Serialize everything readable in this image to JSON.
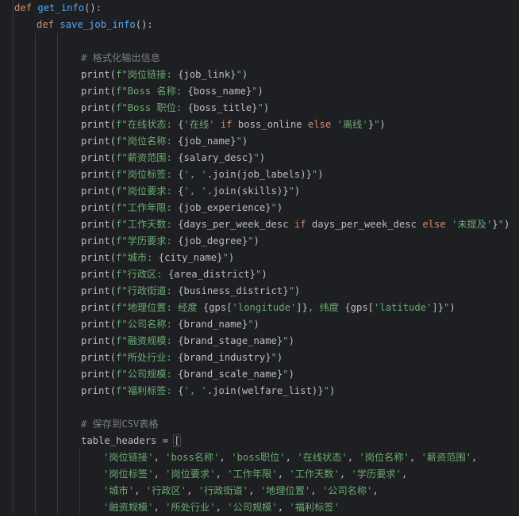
{
  "lines": [
    [
      [
        "kw",
        "def "
      ],
      [
        "fn",
        "get_info"
      ],
      [
        "plain",
        "():"
      ]
    ],
    [
      [
        "kw",
        "def "
      ],
      [
        "fn",
        "save_job_info"
      ],
      [
        "plain",
        "():"
      ]
    ],
    [],
    [
      [
        "cmt",
        "# 格式化输出信息"
      ]
    ],
    [
      [
        "plain",
        "print("
      ],
      [
        "str",
        "f\"岗位链接: "
      ],
      [
        "plain",
        "{job_link}"
      ],
      [
        "str",
        "\""
      ],
      [
        "plain",
        ")"
      ]
    ],
    [
      [
        "plain",
        "print("
      ],
      [
        "str",
        "f\"Boss 名称: "
      ],
      [
        "plain",
        "{boss_name}"
      ],
      [
        "str",
        "\""
      ],
      [
        "plain",
        ")"
      ]
    ],
    [
      [
        "plain",
        "print("
      ],
      [
        "str",
        "f\"Boss 职位: "
      ],
      [
        "plain",
        "{boss_title}"
      ],
      [
        "str",
        "\""
      ],
      [
        "plain",
        ")"
      ]
    ],
    [
      [
        "plain",
        "print("
      ],
      [
        "str",
        "f\"在线状态: "
      ],
      [
        "plain",
        "{"
      ],
      [
        "str",
        "'在线'"
      ],
      [
        "kw",
        " if "
      ],
      [
        "plain",
        "boss_online"
      ],
      [
        "kw",
        " else "
      ],
      [
        "str",
        "'离线'"
      ],
      [
        "plain",
        "}"
      ],
      [
        "str",
        "\""
      ],
      [
        "plain",
        ")"
      ]
    ],
    [
      [
        "plain",
        "print("
      ],
      [
        "str",
        "f\"岗位名称: "
      ],
      [
        "plain",
        "{job_name}"
      ],
      [
        "str",
        "\""
      ],
      [
        "plain",
        ")"
      ]
    ],
    [
      [
        "plain",
        "print("
      ],
      [
        "str",
        "f\"薪资范围: "
      ],
      [
        "plain",
        "{salary_desc}"
      ],
      [
        "str",
        "\""
      ],
      [
        "plain",
        ")"
      ]
    ],
    [
      [
        "plain",
        "print("
      ],
      [
        "str",
        "f\"岗位标签: "
      ],
      [
        "plain",
        "{"
      ],
      [
        "str",
        "', '"
      ],
      [
        "plain",
        ".join(job_labels)}"
      ],
      [
        "str",
        "\""
      ],
      [
        "plain",
        ")"
      ]
    ],
    [
      [
        "plain",
        "print("
      ],
      [
        "str",
        "f\"岗位要求: "
      ],
      [
        "plain",
        "{"
      ],
      [
        "str",
        "', '"
      ],
      [
        "plain",
        ".join(skills)}"
      ],
      [
        "str",
        "\""
      ],
      [
        "plain",
        ")"
      ]
    ],
    [
      [
        "plain",
        "print("
      ],
      [
        "str",
        "f\"工作年限: "
      ],
      [
        "plain",
        "{job_experience}"
      ],
      [
        "str",
        "\""
      ],
      [
        "plain",
        ")"
      ]
    ],
    [
      [
        "plain",
        "print("
      ],
      [
        "str",
        "f\"工作天数: "
      ],
      [
        "plain",
        "{days_per_week_desc"
      ],
      [
        "kw",
        " if "
      ],
      [
        "plain",
        "days_per_week_desc"
      ],
      [
        "kw",
        " else "
      ],
      [
        "str",
        "'未提及'"
      ],
      [
        "plain",
        "}"
      ],
      [
        "str",
        "\""
      ],
      [
        "plain",
        ")"
      ]
    ],
    [
      [
        "plain",
        "print("
      ],
      [
        "str",
        "f\"学历要求: "
      ],
      [
        "plain",
        "{job_degree}"
      ],
      [
        "str",
        "\""
      ],
      [
        "plain",
        ")"
      ]
    ],
    [
      [
        "plain",
        "print("
      ],
      [
        "str",
        "f\"城市: "
      ],
      [
        "plain",
        "{city_name}"
      ],
      [
        "str",
        "\""
      ],
      [
        "plain",
        ")"
      ]
    ],
    [
      [
        "plain",
        "print("
      ],
      [
        "str",
        "f\"行政区: "
      ],
      [
        "plain",
        "{area_district}"
      ],
      [
        "str",
        "\""
      ],
      [
        "plain",
        ")"
      ]
    ],
    [
      [
        "plain",
        "print("
      ],
      [
        "str",
        "f\"行政街道: "
      ],
      [
        "plain",
        "{business_district}"
      ],
      [
        "str",
        "\""
      ],
      [
        "plain",
        ")"
      ]
    ],
    [
      [
        "plain",
        "print("
      ],
      [
        "str",
        "f\"地理位置: 经度 "
      ],
      [
        "plain",
        "{gps["
      ],
      [
        "str",
        "'longitude'"
      ],
      [
        "plain",
        "]}"
      ],
      [
        "str",
        ", 纬度 "
      ],
      [
        "plain",
        "{gps["
      ],
      [
        "str",
        "'latitude'"
      ],
      [
        "plain",
        "]}"
      ],
      [
        "str",
        "\""
      ],
      [
        "plain",
        ")"
      ]
    ],
    [
      [
        "plain",
        "print("
      ],
      [
        "str",
        "f\"公司名称: "
      ],
      [
        "plain",
        "{brand_name}"
      ],
      [
        "str",
        "\""
      ],
      [
        "plain",
        ")"
      ]
    ],
    [
      [
        "plain",
        "print("
      ],
      [
        "str",
        "f\"融资规模: "
      ],
      [
        "plain",
        "{brand_stage_name}"
      ],
      [
        "str",
        "\""
      ],
      [
        "plain",
        ")"
      ]
    ],
    [
      [
        "plain",
        "print("
      ],
      [
        "str",
        "f\"所处行业: "
      ],
      [
        "plain",
        "{brand_industry}"
      ],
      [
        "str",
        "\""
      ],
      [
        "plain",
        ")"
      ]
    ],
    [
      [
        "plain",
        "print("
      ],
      [
        "str",
        "f\"公司规模: "
      ],
      [
        "plain",
        "{brand_scale_name}"
      ],
      [
        "str",
        "\""
      ],
      [
        "plain",
        ")"
      ]
    ],
    [
      [
        "plain",
        "print("
      ],
      [
        "str",
        "f\"福利标签: "
      ],
      [
        "plain",
        "{"
      ],
      [
        "str",
        "', '"
      ],
      [
        "plain",
        ".join(welfare_list)}"
      ],
      [
        "str",
        "\""
      ],
      [
        "plain",
        ")"
      ]
    ],
    [],
    [
      [
        "cmt",
        "# 保存到CSV表格"
      ]
    ],
    [
      [
        "plain",
        "table_headers = "
      ],
      [
        "plain",
        "["
      ]
    ],
    [
      [
        "str",
        "'岗位链接'"
      ],
      [
        "plain",
        ", "
      ],
      [
        "str",
        "'boss名称'"
      ],
      [
        "plain",
        ", "
      ],
      [
        "str",
        "'boss职位'"
      ],
      [
        "plain",
        ", "
      ],
      [
        "str",
        "'在线状态'"
      ],
      [
        "plain",
        ", "
      ],
      [
        "str",
        "'岗位名称'"
      ],
      [
        "plain",
        ", "
      ],
      [
        "str",
        "'薪资范围'"
      ],
      [
        "plain",
        ","
      ]
    ],
    [
      [
        "str",
        "'岗位标签'"
      ],
      [
        "plain",
        ", "
      ],
      [
        "str",
        "'岗位要求'"
      ],
      [
        "plain",
        ", "
      ],
      [
        "str",
        "'工作年限'"
      ],
      [
        "plain",
        ", "
      ],
      [
        "str",
        "'工作天数'"
      ],
      [
        "plain",
        ", "
      ],
      [
        "str",
        "'学历要求'"
      ],
      [
        "plain",
        ","
      ]
    ],
    [
      [
        "str",
        "'城市'"
      ],
      [
        "plain",
        ", "
      ],
      [
        "str",
        "'行政区'"
      ],
      [
        "plain",
        ", "
      ],
      [
        "str",
        "'行政街道'"
      ],
      [
        "plain",
        ", "
      ],
      [
        "str",
        "'地理位置'"
      ],
      [
        "plain",
        ", "
      ],
      [
        "str",
        "'公司名称'"
      ],
      [
        "plain",
        ","
      ]
    ],
    [
      [
        "str",
        "'融资规模'"
      ],
      [
        "plain",
        ", "
      ],
      [
        "str",
        "'所处行业'"
      ],
      [
        "plain",
        ", "
      ],
      [
        "str",
        "'公司规模'"
      ],
      [
        "plain",
        ", "
      ],
      [
        "str",
        "'福利标签'"
      ]
    ]
  ]
}
